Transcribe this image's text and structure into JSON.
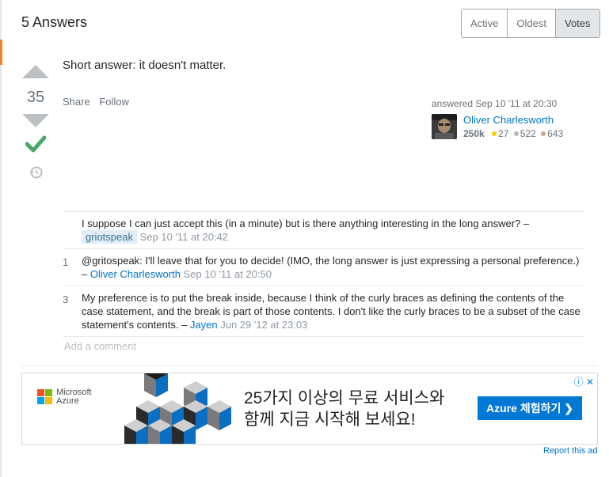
{
  "header": {
    "answers_title": "5 Answers",
    "sort_tabs": [
      {
        "label": "Active",
        "active": false
      },
      {
        "label": "Oldest",
        "active": false
      },
      {
        "label": "Votes",
        "active": true
      }
    ]
  },
  "answer": {
    "score": "35",
    "body": "Short answer: it doesn't matter.",
    "menu": {
      "share": "Share",
      "follow": "Follow"
    },
    "user": {
      "action": "answered",
      "timestamp": "Sep 10 '11 at 20:30",
      "name": "Oliver Charlesworth",
      "reputation": "250k",
      "gold": "27",
      "silver": "522",
      "bronze": "643"
    }
  },
  "comments": [
    {
      "score": "",
      "text": "I suppose I can just accept this (in a minute) but is there anything interesting in the long answer? – ",
      "user": "griotspeak",
      "date": "Sep 10 '11 at 20:42"
    },
    {
      "score": "1",
      "text": "@gritospeak: I'll leave that for you to decide! (IMO, the long answer is just expressing a personal preference.) – ",
      "user": "Oliver Charlesworth",
      "date": "Sep 10 '11 at 20:50"
    },
    {
      "score": "3",
      "text": "My preference is to put the break inside, because I think of the curly braces as defining the contents of the case statement, and the break is part of those contents. I don't like the curly braces to be a subset of the case statement's contents. – ",
      "user": "Jayen",
      "date": "Jun 29 '12 at 23:03"
    }
  ],
  "add_comment": "Add a comment",
  "ad": {
    "brand_line1": "Microsoft",
    "brand_line2": "Azure",
    "headline_line1": "25가지 이상의 무료 서비스와",
    "headline_line2": "함께 지금 시작해 보세요!",
    "cta": "Azure 체험하기 ❯",
    "report": "Report this ad"
  },
  "colors": {
    "accent": "#f48225",
    "link": "#0074cc",
    "accepted": "#48a868",
    "badge_gold": "#ffcc01",
    "badge_silver": "#b4b8bc",
    "badge_bronze": "#d1a684",
    "azure": "#0078d4"
  }
}
